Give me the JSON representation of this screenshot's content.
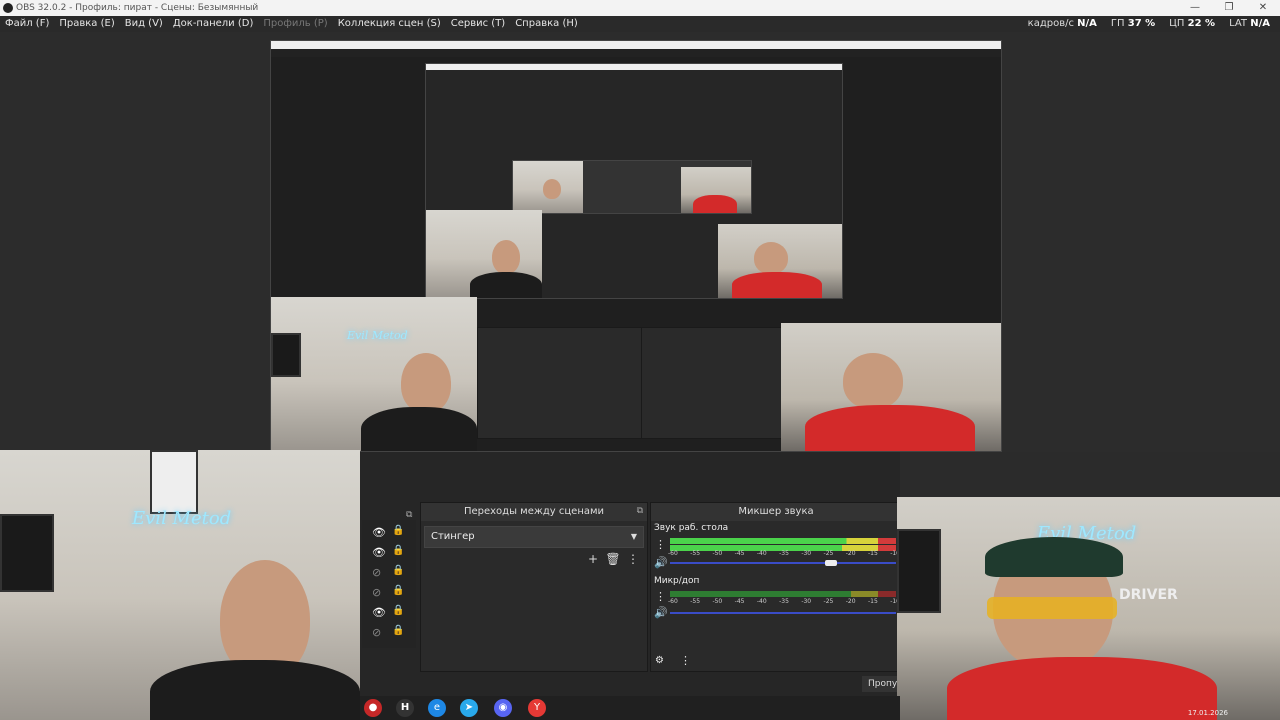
{
  "window": {
    "title": "OBS 32.0.2 - Профиль: пират - Сцены: Безымянный",
    "controls": [
      "—",
      "❐",
      "✕"
    ]
  },
  "menu": {
    "items": [
      "Файл (F)",
      "Правка (E)",
      "Вид (V)",
      "Док-панели (D)",
      "Профиль (P)",
      "Коллекция сцен (S)",
      "Сервис (T)",
      "Справка (H)"
    ]
  },
  "stats": {
    "fps_label": "кадров/с",
    "fps_value": "N/A",
    "gpu_label": "ГП",
    "gpu_value": "37 %",
    "cpu_label": "ЦП",
    "cpu_value": "22 %",
    "lat_label": "LAT",
    "lat_value": "N/A"
  },
  "cams": {
    "left_sign": "Evil Metod",
    "right_sign": "Evil Metod",
    "right_banner": "DRIVER"
  },
  "transitions_panel": {
    "title": "Переходы между сценами",
    "selected": "Стингер"
  },
  "mixer_panel": {
    "title": "Микшер звука",
    "channel1": "Звук раб. стола",
    "channel2": "Микр/доп",
    "scale": [
      "-60",
      "-55",
      "-50",
      "-45",
      "-40",
      "-35",
      "-30",
      "-25",
      "-20",
      "-15",
      "-10",
      "-5"
    ]
  },
  "controls": {
    "skip_label": "Пропу"
  },
  "taskbar": {
    "clock": "17.01.2026"
  }
}
